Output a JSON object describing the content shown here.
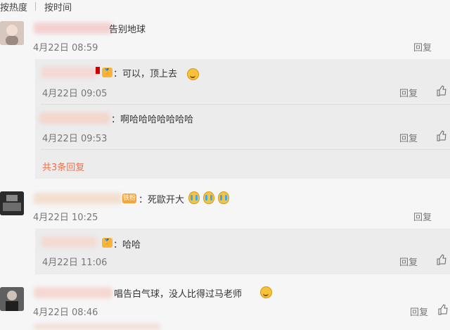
{
  "sort": {
    "hot": "按热度",
    "time": "按时间"
  },
  "comments": [
    {
      "text": "告别地球",
      "time": "4月22日 08:59",
      "reply": "回复",
      "replies": [
        {
          "text": "：可以，顶上去",
          "time": "4月22日 09:05",
          "reply": "回复"
        },
        {
          "text": "：啊哈哈哈哈哈哈哈",
          "time": "4月22日 09:53",
          "reply": "回复"
        }
      ],
      "more": "共3条回复"
    },
    {
      "text": "：死歐开大",
      "time": "4月22日 10:25",
      "reply": "回复",
      "replies": [
        {
          "text": "：哈哈",
          "time": "4月22日 11:06",
          "reply": "回复"
        }
      ]
    },
    {
      "text": "唱告白气球，没人比得过马老师",
      "time": "4月22日 08:46",
      "reply": "回复"
    }
  ],
  "colors": {
    "accent": "#eb7350",
    "text": "#333333",
    "muted": "#777777",
    "background": "#f6f6f6",
    "reply_background": "#ececec"
  },
  "icons": [
    "thumb-up-icon",
    "emoji-smile-icon",
    "emoji-cry-icon",
    "vip-badge-icon"
  ]
}
